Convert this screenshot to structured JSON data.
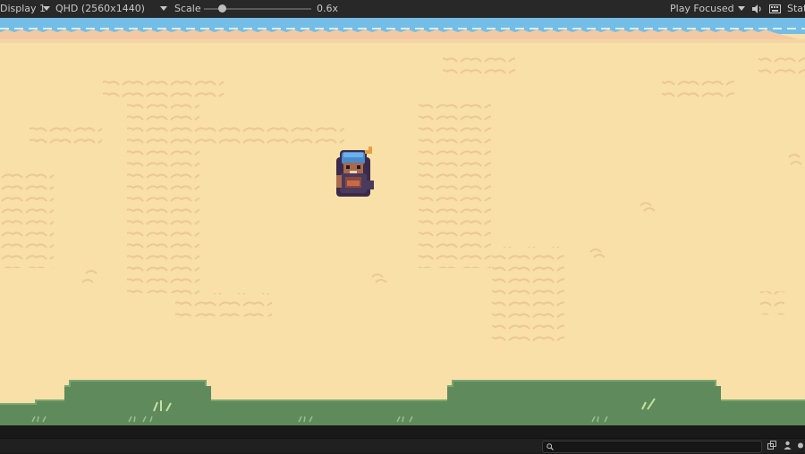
{
  "toolbar": {
    "display": "Display 1",
    "resolution": "QHD (2560x1440)",
    "scale_label": "Scale",
    "scale_value": "0.6x",
    "scale_fraction": 0.17,
    "play_mode": "Play Focused",
    "stats_label": "Stats"
  },
  "icons": {
    "audio": "speaker-icon",
    "keyboard": "keyboard-icon",
    "search": "search-icon",
    "layers": "layers-icon",
    "person": "person-icon"
  },
  "colors": {
    "sand": "#f8e0a8",
    "sand_pattern": "#ecc894",
    "water": "#73bde6",
    "grass": "#5f8a5c",
    "toolbar": "#282828"
  }
}
